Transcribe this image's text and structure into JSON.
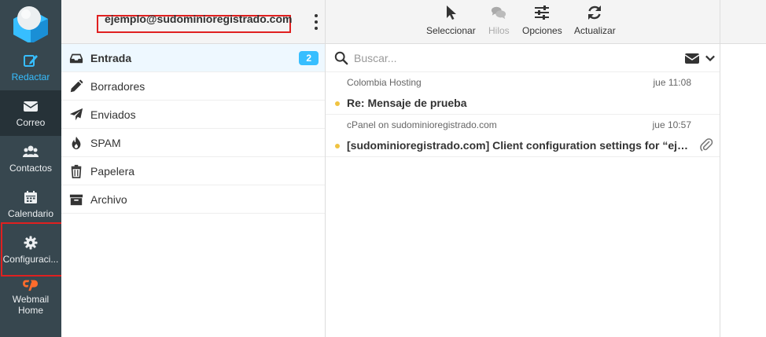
{
  "nav": {
    "compose": "Redactar",
    "mail": "Correo",
    "contacts": "Contactos",
    "calendar": "Calendario",
    "settings": "Configuraci...",
    "webmail_home": "Webmail Home"
  },
  "account": {
    "email": "ejemplo@sudominioregistrado.com"
  },
  "folders": [
    {
      "label": "Entrada",
      "icon": "inbox-icon",
      "unread": "2"
    },
    {
      "label": "Borradores",
      "icon": "pencil-icon"
    },
    {
      "label": "Enviados",
      "icon": "paper-plane-icon"
    },
    {
      "label": "SPAM",
      "icon": "fire-icon"
    },
    {
      "label": "Papelera",
      "icon": "trash-icon"
    },
    {
      "label": "Archivo",
      "icon": "archive-icon"
    }
  ],
  "toolbar": {
    "select": "Seleccionar",
    "threads": "Hilos",
    "options": "Opciones",
    "refresh": "Actualizar"
  },
  "search": {
    "placeholder": "Buscar..."
  },
  "messages": [
    {
      "from": "Colombia Hosting",
      "date": "jue 11:08",
      "subject": "Re: Mensaje de prueba"
    },
    {
      "from": "cPanel on sudominioregistrado.com",
      "date": "jue 10:57",
      "subject": "[sudominioregistrado.com] Client configuration settings for “ejemplo@sudominioregistrado.com”"
    }
  ],
  "colors": {
    "nav_bg": "#37474f",
    "nav_active": "#263238",
    "accent": "#37beff",
    "highlight_box": "#e02020",
    "unread_dot": "#f0c341",
    "cpanel_orange": "#ff6c2c"
  }
}
